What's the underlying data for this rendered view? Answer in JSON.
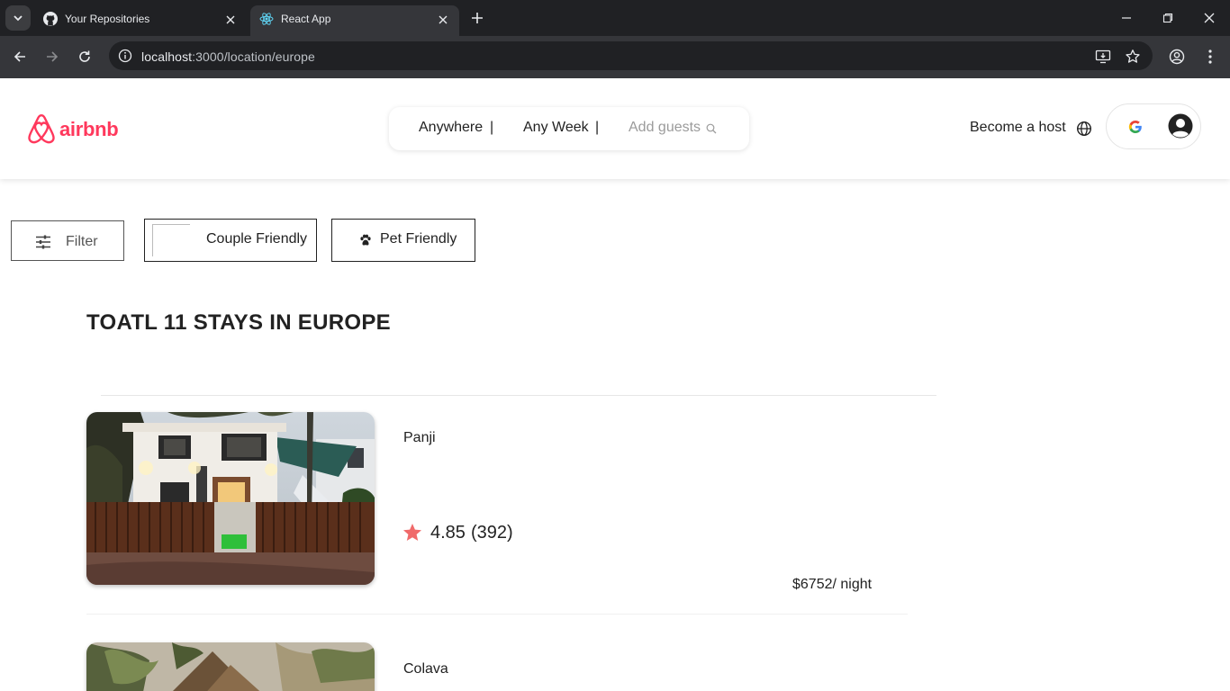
{
  "browser": {
    "tabs": [
      {
        "title": "Your Repositories",
        "active": false,
        "icon": "github-icon"
      },
      {
        "title": "React App",
        "active": true,
        "icon": "react-icon"
      }
    ],
    "url_host": "localhost",
    "url_path": ":3000/location/europe"
  },
  "header": {
    "logo_text": "airbnb",
    "brand_color": "#ff385c",
    "search": {
      "where": "Anywhere",
      "when": "Any Week",
      "who": "Add guests"
    },
    "host_label": "Become a host"
  },
  "filters": {
    "filter_label": "Filter",
    "chips": [
      {
        "label": "Couple Friendly",
        "icon": "broken-image-icon"
      },
      {
        "label": "Pet Friendly",
        "icon": "paw-icon"
      }
    ]
  },
  "main": {
    "title": "TOATL 11 STAYS IN EUROPE",
    "listings": [
      {
        "name": "Panji",
        "rating": "4.85",
        "reviews": "(392)",
        "price": "$6752/ night"
      },
      {
        "name": "Colava"
      }
    ]
  }
}
